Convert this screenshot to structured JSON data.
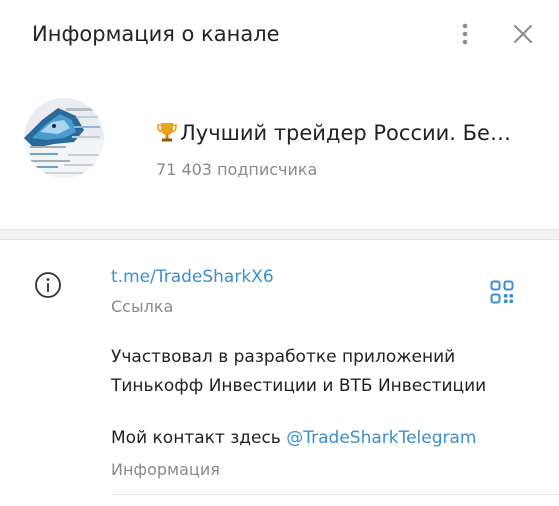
{
  "header": {
    "title": "Информация о канале",
    "menu_icon": "more-vertical-icon",
    "close_icon": "close-icon"
  },
  "channel": {
    "name": "Лучший трейдер России. Бе…",
    "name_prefix_icon": "trophy-icon",
    "subscribers": "71 403 подписчика"
  },
  "info": {
    "icon": "info-icon",
    "link": "t.me/TradeSharkX6",
    "link_caption": "Ссылка",
    "qr_icon": "qr-code-icon",
    "description_line1": "Участвовал в разработке приложений",
    "description_line2": "Тинькофф Инвестиции и ВТБ Инвестиции",
    "contact_prefix": "Мой контакт здесь ",
    "contact_mention": "@TradeSharkTelegram",
    "info_caption": "Информация"
  },
  "colors": {
    "accent": "#3a8fd0",
    "secondary_text": "#8a8a8a",
    "divider": "#f1f1f1"
  }
}
